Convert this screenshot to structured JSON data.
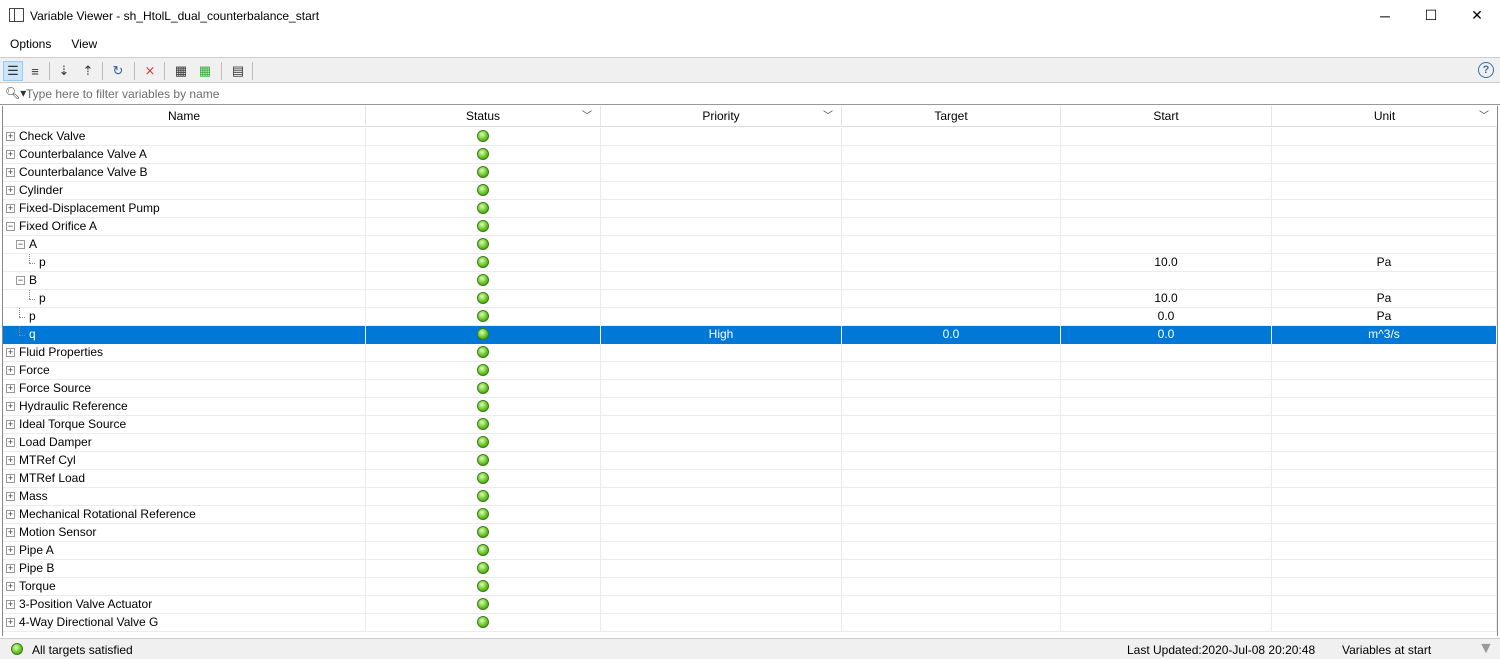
{
  "window": {
    "title": "Variable Viewer - sh_HtolL_dual_counterbalance_start",
    "minimize": "─",
    "maximize": "☐",
    "close": "✕"
  },
  "menu": [
    "Options",
    "View"
  ],
  "toolbar": {
    "help": "?"
  },
  "filter": {
    "placeholder": "Type here to filter variables by name",
    "value": ""
  },
  "columns": [
    "Name",
    "Status",
    "Priority",
    "Target",
    "Start",
    "Unit"
  ],
  "rows": [
    {
      "name": "Check Valve",
      "level": 0,
      "exp": "+"
    },
    {
      "name": "Counterbalance Valve A",
      "level": 0,
      "exp": "+"
    },
    {
      "name": "Counterbalance Valve B",
      "level": 0,
      "exp": "+"
    },
    {
      "name": "Cylinder",
      "level": 0,
      "exp": "+"
    },
    {
      "name": "Fixed-Displacement Pump",
      "level": 0,
      "exp": "+"
    },
    {
      "name": "Fixed Orifice A",
      "level": 0,
      "exp": "-"
    },
    {
      "name": "A",
      "level": 1,
      "exp": "-"
    },
    {
      "name": "p",
      "level": 2,
      "start": "10.0",
      "unit": "Pa"
    },
    {
      "name": "B",
      "level": 1,
      "exp": "-"
    },
    {
      "name": "p",
      "level": 2,
      "start": "10.0",
      "unit": "Pa"
    },
    {
      "name": "p",
      "level": 1,
      "start": "0.0",
      "unit": "Pa"
    },
    {
      "name": "q",
      "level": 1,
      "priority": "High",
      "target": "0.0",
      "start": "0.0",
      "unit": "m^3/s",
      "selected": true
    },
    {
      "name": "Fluid Properties",
      "level": 0,
      "exp": "+"
    },
    {
      "name": "Force",
      "level": 0,
      "exp": "+"
    },
    {
      "name": "Force Source",
      "level": 0,
      "exp": "+"
    },
    {
      "name": "Hydraulic Reference",
      "level": 0,
      "exp": "+"
    },
    {
      "name": "Ideal Torque Source",
      "level": 0,
      "exp": "+"
    },
    {
      "name": "Load Damper",
      "level": 0,
      "exp": "+"
    },
    {
      "name": "MTRef Cyl",
      "level": 0,
      "exp": "+"
    },
    {
      "name": "MTRef Load",
      "level": 0,
      "exp": "+"
    },
    {
      "name": "Mass",
      "level": 0,
      "exp": "+"
    },
    {
      "name": "Mechanical Rotational Reference",
      "level": 0,
      "exp": "+"
    },
    {
      "name": "Motion Sensor",
      "level": 0,
      "exp": "+"
    },
    {
      "name": "Pipe A",
      "level": 0,
      "exp": "+"
    },
    {
      "name": "Pipe B",
      "level": 0,
      "exp": "+"
    },
    {
      "name": "Torque",
      "level": 0,
      "exp": "+"
    },
    {
      "name": "3-Position Valve Actuator",
      "level": 0,
      "exp": "+"
    },
    {
      "name": "4-Way Directional Valve G",
      "level": 0,
      "exp": "+"
    }
  ],
  "statusbar": {
    "message": "All targets satisfied",
    "last_updated": "Last Updated:2020-Jul-08 20:20:48",
    "mode": "Variables at start"
  },
  "colors": {
    "selection": "#0078d7",
    "ok": "#5fc01c"
  }
}
